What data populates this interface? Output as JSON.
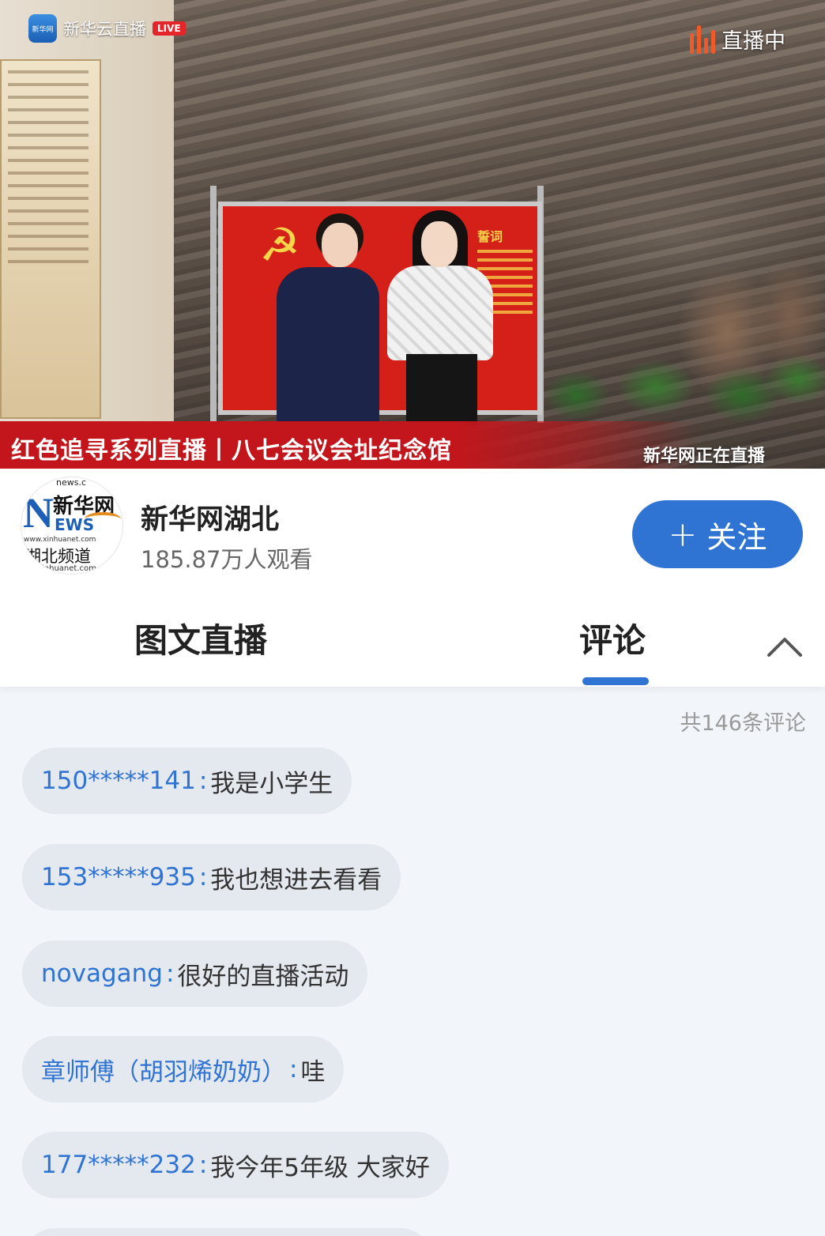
{
  "video": {
    "brand_text": "新华云直播",
    "brand_icon_text": "新华网",
    "live_badge": "LIVE",
    "status_text": "直播中",
    "banner_title": "红色追寻系列直播丨八七会议会址纪念馆",
    "banner_live_text": "新华网正在直播",
    "board_header": "誓词"
  },
  "channel": {
    "avatar": {
      "top": "news.c",
      "cn": "新华网",
      "n": "N",
      "ews": "EWS",
      "url": "www.xinhuanet.com",
      "sub": "湖北频道",
      "bottom": "inhuanet.com"
    },
    "name": "新华网湖北",
    "viewers": "185.87万人观看",
    "follow_plus": "+",
    "follow_label": "关注"
  },
  "tabs": {
    "items": [
      {
        "label": "图文直播",
        "active": false
      },
      {
        "label": "评论",
        "active": true
      }
    ]
  },
  "comments": {
    "count_text": "共146条评论",
    "separator": ":",
    "items": [
      {
        "user": "150*****141",
        "text": "我是小学生"
      },
      {
        "user": "153*****935",
        "text": "我也想进去看看"
      },
      {
        "user": "novagang",
        "text": "很好的直播活动"
      },
      {
        "user": "章师傅（胡羽烯奶奶）",
        "text": "哇"
      },
      {
        "user": "177*****232",
        "text": "我今年5年级 大家好"
      }
    ]
  },
  "colors": {
    "accent": "#2f73d3",
    "banner_red": "#c3161c",
    "live_orange": "#f05a28",
    "bubble_bg": "#e4e8ef",
    "page_bg": "#f2f5fa"
  }
}
